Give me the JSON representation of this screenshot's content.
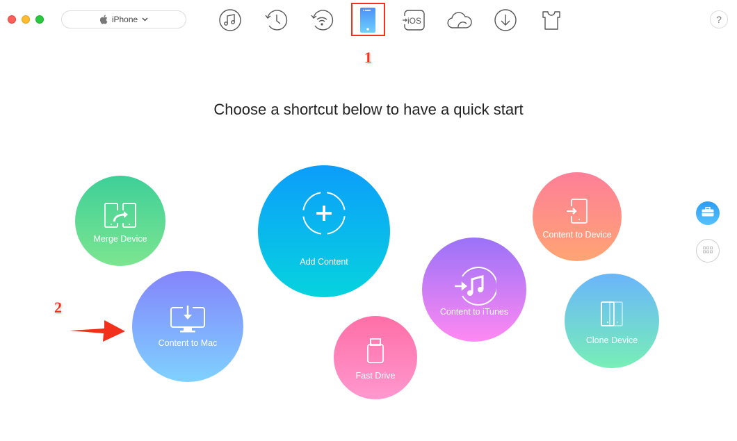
{
  "window": {
    "controls": [
      "close",
      "minimize",
      "maximize"
    ]
  },
  "device_selector": {
    "icon": "apple-icon",
    "label": "iPhone",
    "chevron": "chevron-down-icon"
  },
  "toolbar": {
    "items": [
      {
        "name": "itunes-library",
        "icon": "music-note-icon"
      },
      {
        "name": "icloud-backup-history",
        "icon": "history-clock-icon"
      },
      {
        "name": "airbackup",
        "icon": "wifi-backup-icon"
      },
      {
        "name": "device-manager",
        "icon": "phone-icon",
        "active": true
      },
      {
        "name": "ios-mover",
        "icon": "to-ios-icon",
        "text": "iOS"
      },
      {
        "name": "icloud-manager",
        "icon": "cloud-icon"
      },
      {
        "name": "content-downloader",
        "icon": "download-icon"
      },
      {
        "name": "ringtone-maker",
        "icon": "tshirt-icon"
      }
    ],
    "help_label": "?"
  },
  "annotations": {
    "step1": "1",
    "step2": "2"
  },
  "headline": "Choose a shortcut below to have a quick start",
  "shortcuts": [
    {
      "id": "merge-device",
      "label": "Merge Device",
      "icon": "merge-device-icon",
      "colors": [
        "#3ecf98",
        "#7ce590"
      ]
    },
    {
      "id": "add-content",
      "label": "Add Content",
      "icon": "add-icon",
      "colors": [
        "#0c9dfb",
        "#06d3de"
      ]
    },
    {
      "id": "content-to-device",
      "label": "Content to Device",
      "icon": "content-to-device-icon",
      "colors": [
        "#fe7f98",
        "#ffa473"
      ]
    },
    {
      "id": "content-to-mac",
      "label": "Content to Mac",
      "icon": "monitor-download-icon",
      "colors": [
        "#8484fb",
        "#7fd1ff"
      ]
    },
    {
      "id": "fast-drive",
      "label": "Fast Drive",
      "icon": "usb-drive-icon",
      "colors": [
        "#fe6fa6",
        "#ff98cf"
      ]
    },
    {
      "id": "content-to-itunes",
      "label": "Content to iTunes",
      "icon": "itunes-icon",
      "colors": [
        "#9a72f8",
        "#ff89f2"
      ]
    },
    {
      "id": "clone-device",
      "label": "Clone Device",
      "icon": "clone-device-icon",
      "colors": [
        "#6ab5fb",
        "#78efb7"
      ]
    }
  ],
  "side_buttons": [
    {
      "name": "toolbox",
      "icon": "toolbox-icon",
      "active": true
    },
    {
      "name": "apps",
      "icon": "grid-icon",
      "active": false
    }
  ]
}
